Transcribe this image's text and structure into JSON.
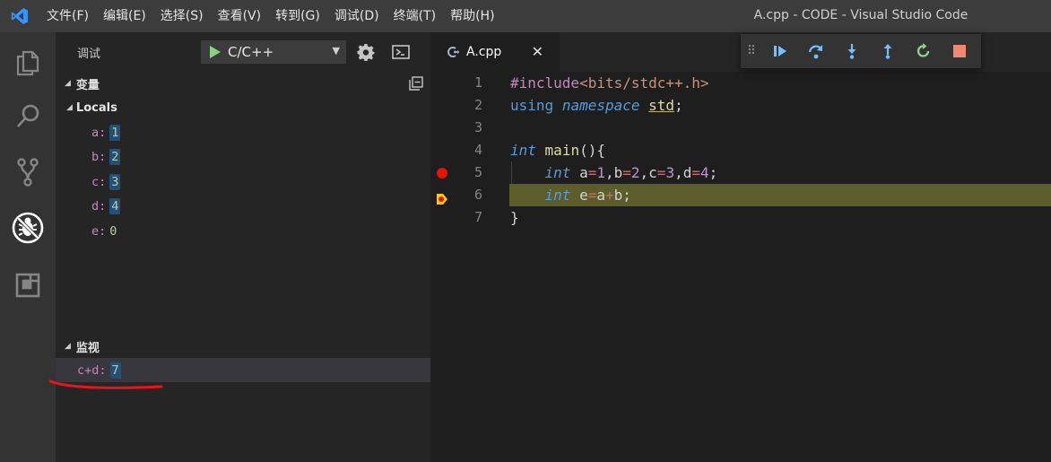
{
  "window": {
    "title": "A.cpp - CODE - Visual Studio Code"
  },
  "menu": {
    "items": [
      "文件(F)",
      "编辑(E)",
      "选择(S)",
      "查看(V)",
      "转到(G)",
      "调试(D)",
      "终端(T)",
      "帮助(H)"
    ]
  },
  "debug": {
    "title": "调试",
    "config": "C/C++",
    "variables_label": "变量",
    "locals_label": "Locals",
    "locals": [
      {
        "name": "a",
        "value": "1"
      },
      {
        "name": "b",
        "value": "2"
      },
      {
        "name": "c",
        "value": "3"
      },
      {
        "name": "d",
        "value": "4"
      },
      {
        "name": "e",
        "value": "0"
      }
    ],
    "watch_label": "监视",
    "watch": {
      "expr": "c+d",
      "value": "7"
    }
  },
  "editor": {
    "tab_label": "A.cpp",
    "close_glyph": "✕",
    "line_numbers": [
      "1",
      "2",
      "3",
      "4",
      "5",
      "6",
      "7"
    ]
  },
  "colors": {
    "accent_blue": "#3794ff",
    "breakpoint": "#e51400",
    "current_line": "#5d5d2b",
    "continue": "#75beff",
    "restart": "#89d185",
    "stop": "#f48771"
  }
}
